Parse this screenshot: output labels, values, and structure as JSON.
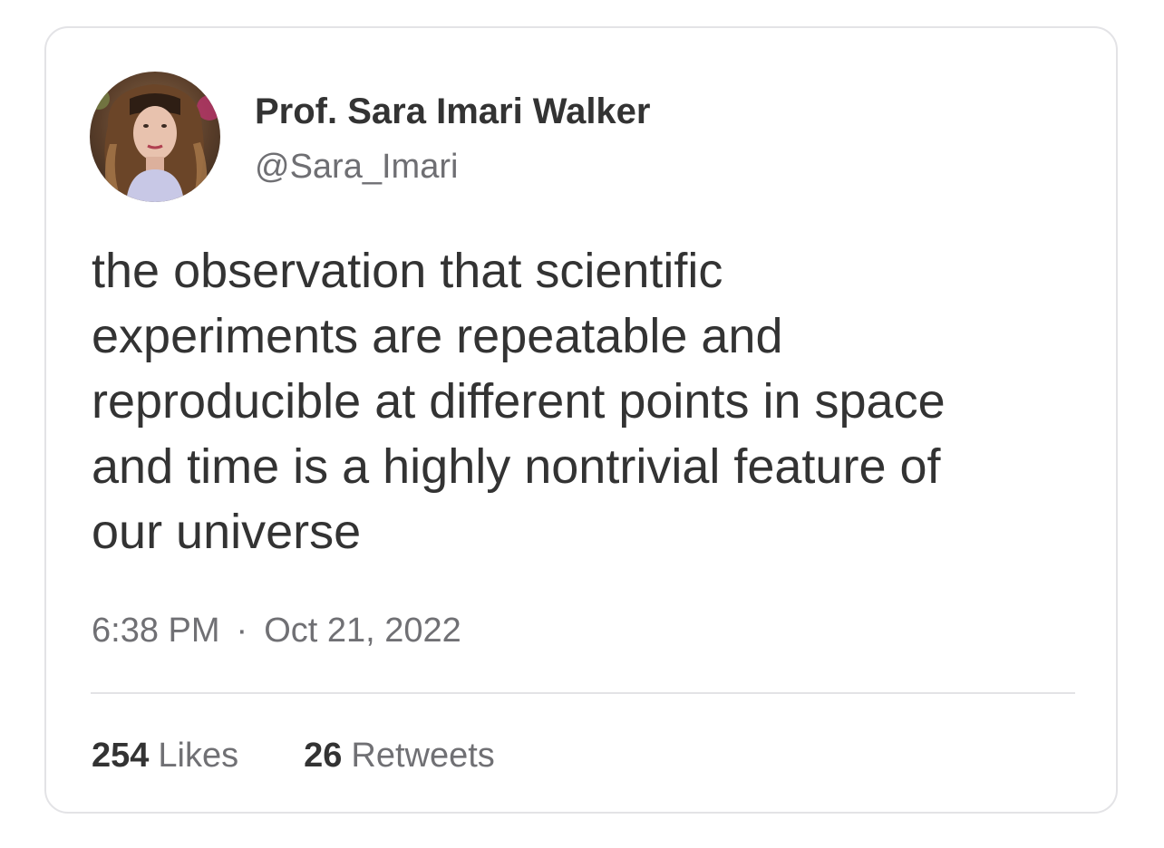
{
  "author": {
    "display_name": "Prof. Sara Imari Walker",
    "handle": "@Sara_Imari",
    "avatar_icon": "profile-photo-avatar"
  },
  "tweet": {
    "text_lines": [
      "the observation that scientific",
      "experiments are repeatable and",
      "reproducible at different points in space",
      "and time is a highly nontrivial feature of",
      "our universe"
    ],
    "time": "6:38 PM",
    "separator": "·",
    "date": "Oct 21, 2022"
  },
  "stats": {
    "likes_count": "254",
    "likes_label": "Likes",
    "retweets_count": "26",
    "retweets_label": "Retweets"
  },
  "colors": {
    "text_primary": "#333333",
    "text_secondary": "#707074",
    "border": "#e3e3e6",
    "background": "#ffffff"
  }
}
